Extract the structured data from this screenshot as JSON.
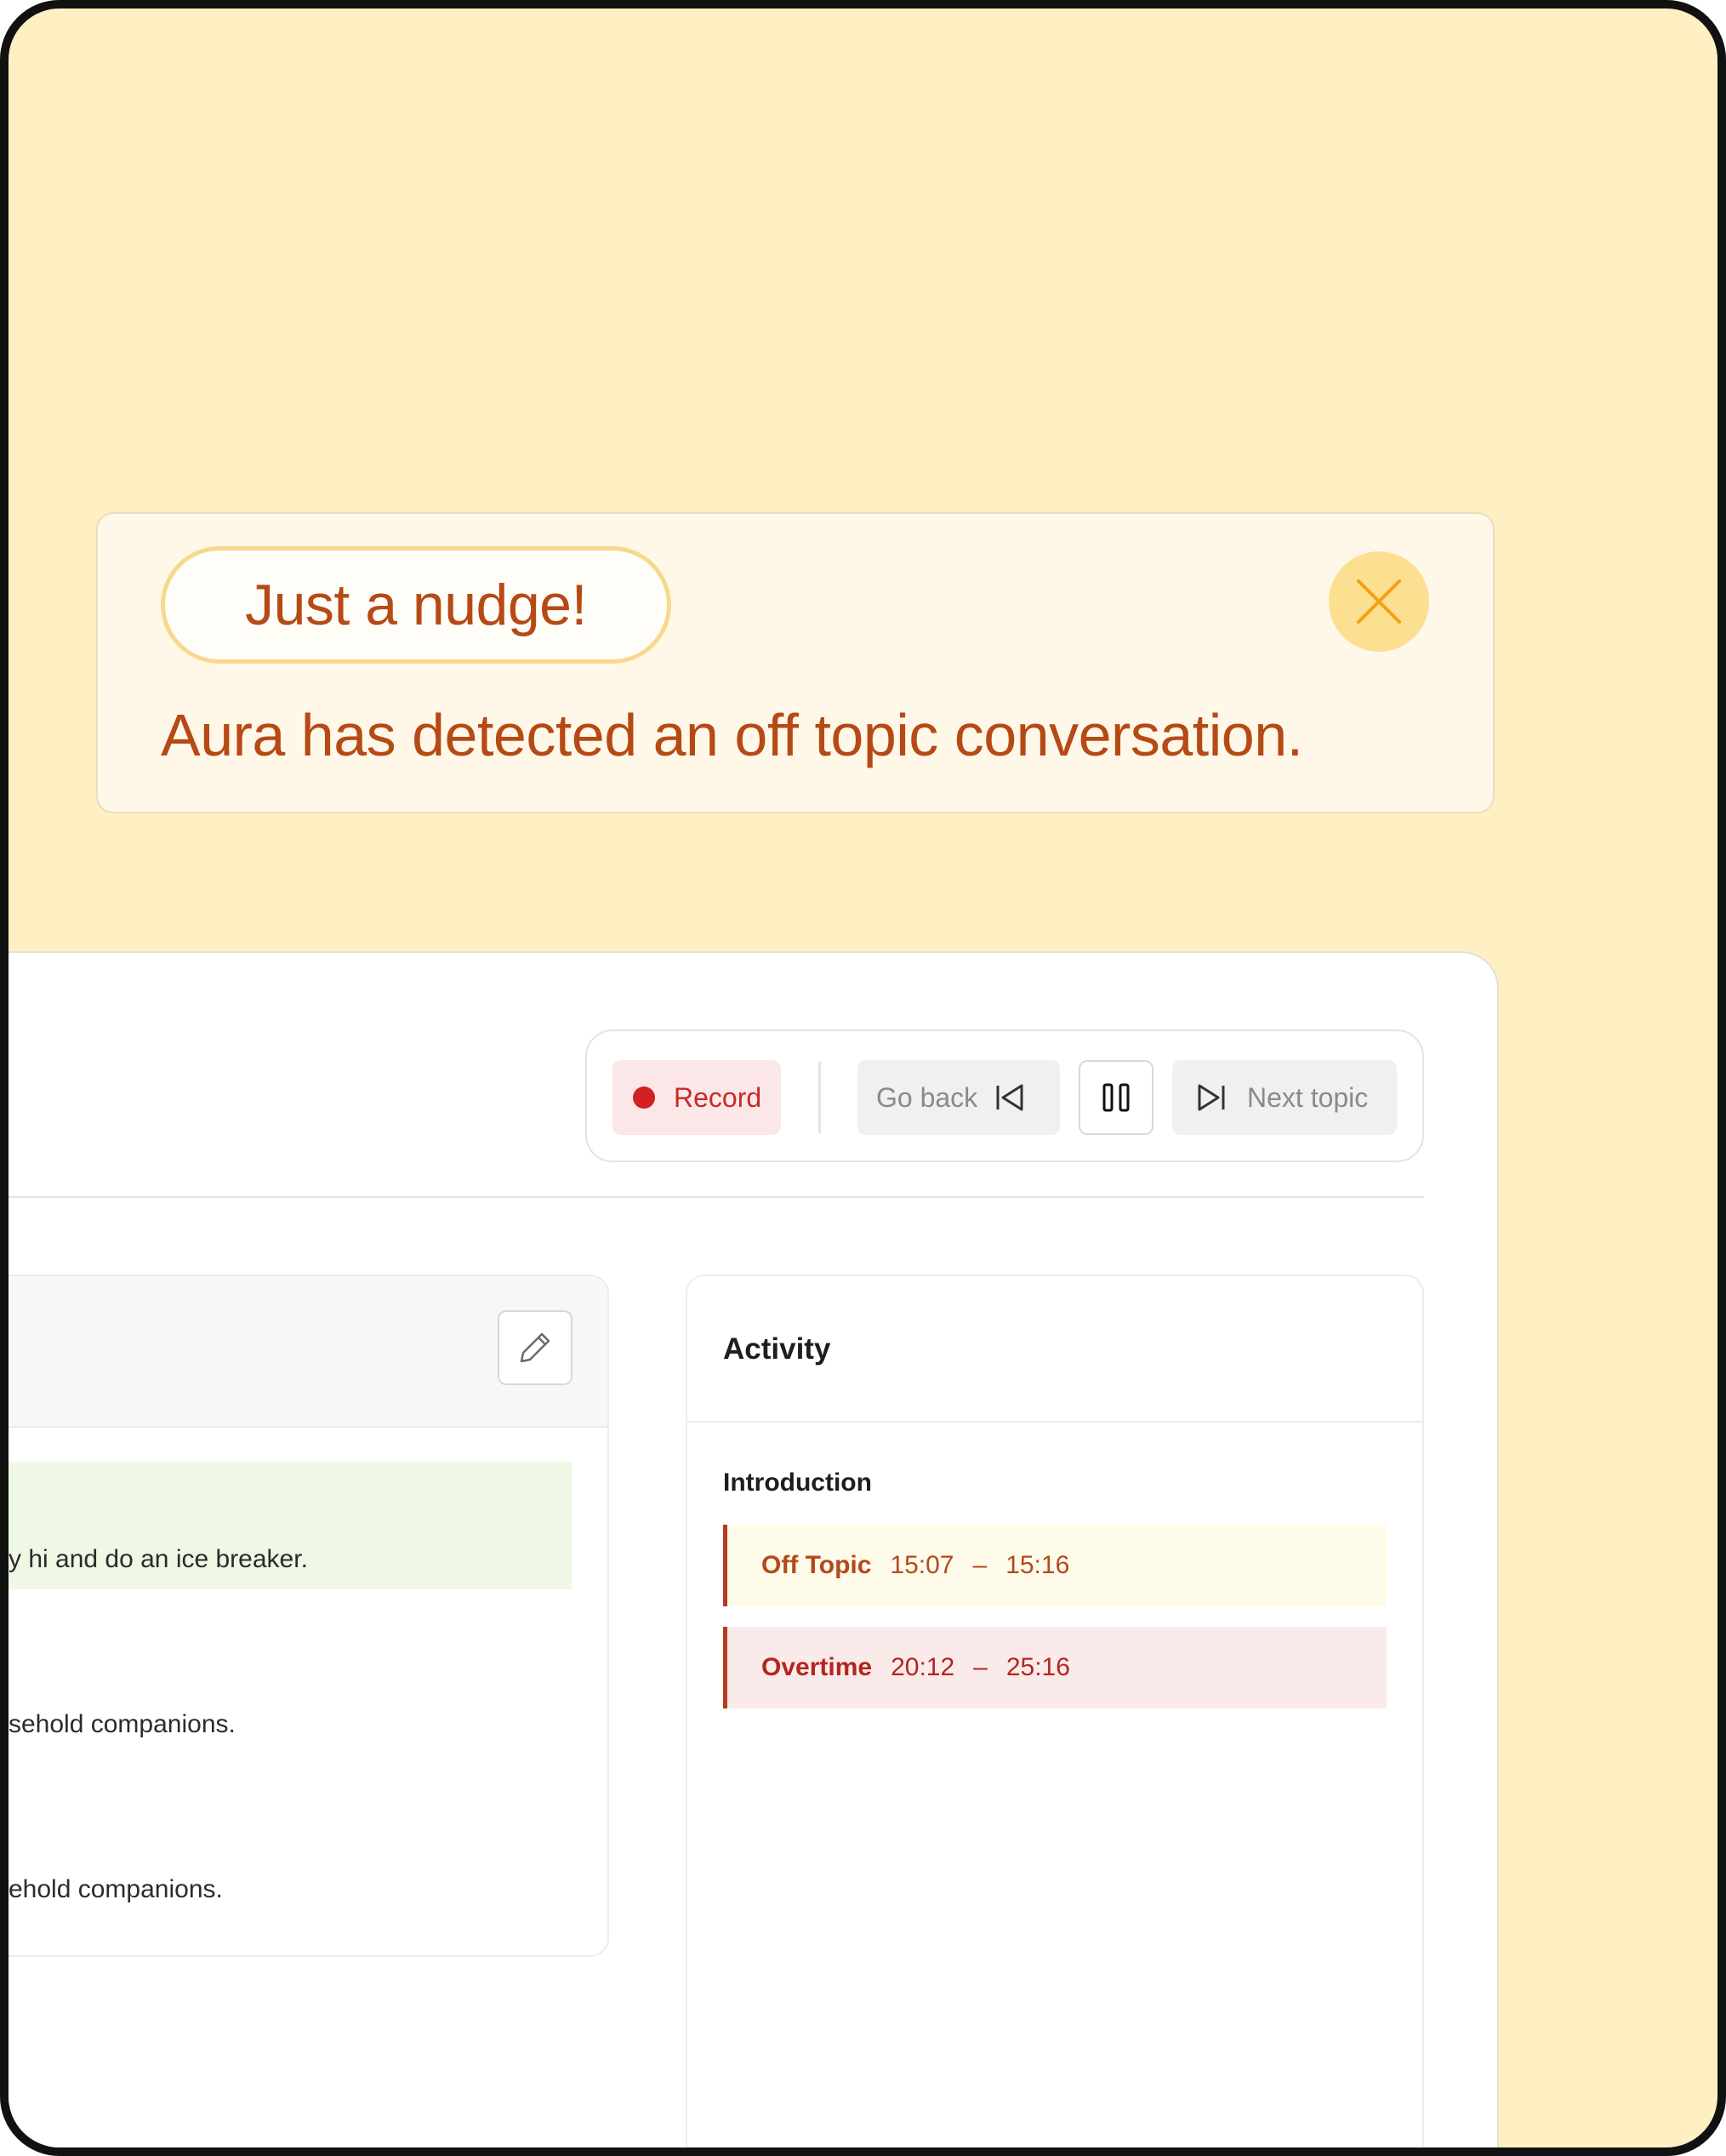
{
  "colors": {
    "backdrop": "#fff0c4",
    "nudge_text": "#b64a15",
    "record_red": "#d32020",
    "off_topic_bg": "#fffbea",
    "overtime_bg": "#fbeaea"
  },
  "nudge": {
    "badge": "Just a nudge!",
    "message": "Aura has detected an off topic conversation.",
    "close_icon": "close-icon"
  },
  "controls": {
    "record_label": "Record",
    "go_back_label": "Go back",
    "next_topic_label": "Next topic",
    "icons": [
      "record-dot-icon",
      "skip-back-icon",
      "pause-icon",
      "skip-forward-icon"
    ]
  },
  "agenda_panel": {
    "edit_icon": "pencil-icon",
    "rows": [
      "y hi and do an ice breaker.",
      "sehold companions.",
      "ehold companions."
    ]
  },
  "activity": {
    "title": "Activity",
    "section": "Introduction",
    "entries": [
      {
        "label": "Off Topic",
        "start": "15:07",
        "sep": "–",
        "end": "15:16"
      },
      {
        "label": "Overtime",
        "start": "20:12",
        "sep": "–",
        "end": "25:16"
      }
    ]
  }
}
